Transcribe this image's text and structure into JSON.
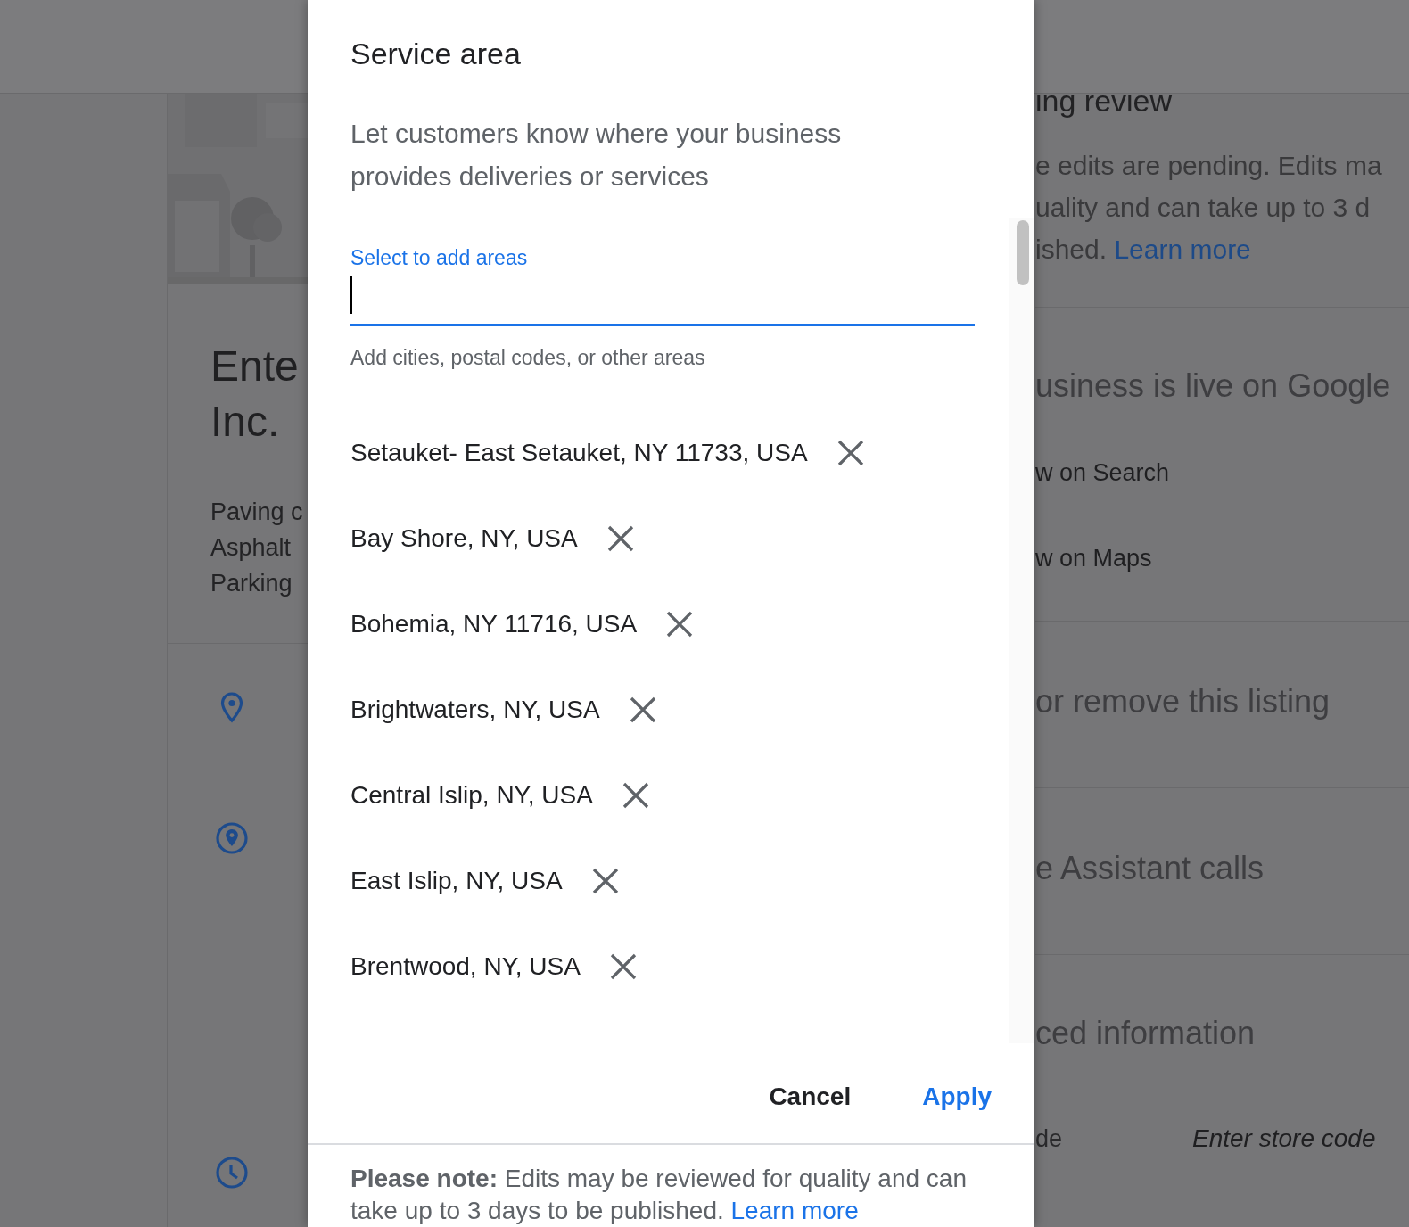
{
  "background": {
    "left_card": {
      "title_lines": [
        "Ente",
        "Inc."
      ],
      "categories": [
        "Paving c",
        "Asphalt",
        "Parking"
      ],
      "rows": [
        {
          "kind": "pin"
        },
        {
          "kind": "area"
        },
        {
          "kind": "clock"
        }
      ]
    },
    "right_panel": {
      "sections": [
        {
          "kind": "notice",
          "heading": "ing review",
          "lines": [
            "e edits are pending. Edits ma",
            "uality and can take up to 3 d"
          ],
          "last_line": "ished.",
          "link": "Learn more"
        },
        {
          "kind": "links",
          "heading": "usiness is live on Google",
          "items": [
            "w on Search",
            "w on Maps"
          ]
        },
        {
          "kind": "heading",
          "heading": "or remove this listing"
        },
        {
          "kind": "heading",
          "heading": "e Assistant calls"
        },
        {
          "kind": "field",
          "heading": "ced information",
          "field_label": "de",
          "placeholder": "Enter store code"
        }
      ]
    }
  },
  "dialog": {
    "title": "Service area",
    "description": "Let customers know where your business provides deliveries or services",
    "input": {
      "label": "Select to add areas",
      "focused": true,
      "helper": "Add cities, postal codes, or other areas"
    },
    "areas": [
      {
        "name": "Setauket- East Setauket, NY 11733, USA"
      },
      {
        "name": "Bay Shore, NY, USA"
      },
      {
        "name": "Bohemia, NY 11716, USA"
      },
      {
        "name": "Brightwaters, NY, USA"
      },
      {
        "name": "Central Islip, NY, USA"
      },
      {
        "name": "East Islip, NY, USA"
      },
      {
        "name": "Brentwood, NY, USA"
      }
    ],
    "buttons": [
      {
        "label": "Cancel",
        "kind": "secondary"
      },
      {
        "label": "Apply",
        "kind": "primary"
      }
    ],
    "note": {
      "text": "**Please note:** Edits may be reviewed for quality and can take up to 3 days to be published.",
      "link": "Learn more"
    }
  }
}
